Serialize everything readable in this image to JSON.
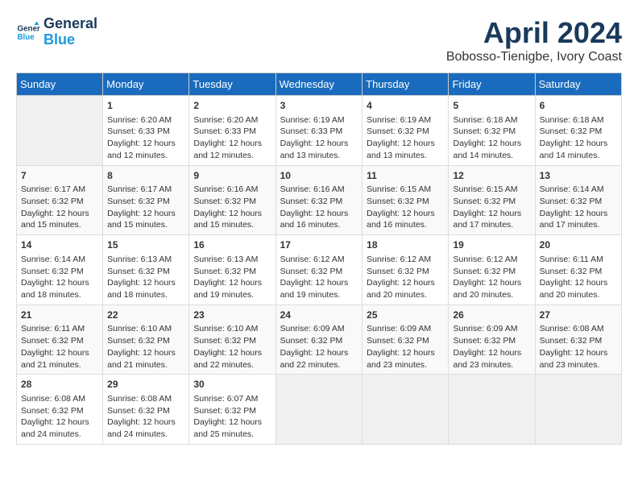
{
  "header": {
    "logo_line1": "General",
    "logo_line2": "Blue",
    "month": "April 2024",
    "location": "Bobosso-Tienigbe, Ivory Coast"
  },
  "days_of_week": [
    "Sunday",
    "Monday",
    "Tuesday",
    "Wednesday",
    "Thursday",
    "Friday",
    "Saturday"
  ],
  "weeks": [
    [
      {
        "num": "",
        "info": ""
      },
      {
        "num": "1",
        "info": "Sunrise: 6:20 AM\nSunset: 6:33 PM\nDaylight: 12 hours\nand 12 minutes."
      },
      {
        "num": "2",
        "info": "Sunrise: 6:20 AM\nSunset: 6:33 PM\nDaylight: 12 hours\nand 12 minutes."
      },
      {
        "num": "3",
        "info": "Sunrise: 6:19 AM\nSunset: 6:33 PM\nDaylight: 12 hours\nand 13 minutes."
      },
      {
        "num": "4",
        "info": "Sunrise: 6:19 AM\nSunset: 6:32 PM\nDaylight: 12 hours\nand 13 minutes."
      },
      {
        "num": "5",
        "info": "Sunrise: 6:18 AM\nSunset: 6:32 PM\nDaylight: 12 hours\nand 14 minutes."
      },
      {
        "num": "6",
        "info": "Sunrise: 6:18 AM\nSunset: 6:32 PM\nDaylight: 12 hours\nand 14 minutes."
      }
    ],
    [
      {
        "num": "7",
        "info": "Sunrise: 6:17 AM\nSunset: 6:32 PM\nDaylight: 12 hours\nand 15 minutes."
      },
      {
        "num": "8",
        "info": "Sunrise: 6:17 AM\nSunset: 6:32 PM\nDaylight: 12 hours\nand 15 minutes."
      },
      {
        "num": "9",
        "info": "Sunrise: 6:16 AM\nSunset: 6:32 PM\nDaylight: 12 hours\nand 15 minutes."
      },
      {
        "num": "10",
        "info": "Sunrise: 6:16 AM\nSunset: 6:32 PM\nDaylight: 12 hours\nand 16 minutes."
      },
      {
        "num": "11",
        "info": "Sunrise: 6:15 AM\nSunset: 6:32 PM\nDaylight: 12 hours\nand 16 minutes."
      },
      {
        "num": "12",
        "info": "Sunrise: 6:15 AM\nSunset: 6:32 PM\nDaylight: 12 hours\nand 17 minutes."
      },
      {
        "num": "13",
        "info": "Sunrise: 6:14 AM\nSunset: 6:32 PM\nDaylight: 12 hours\nand 17 minutes."
      }
    ],
    [
      {
        "num": "14",
        "info": "Sunrise: 6:14 AM\nSunset: 6:32 PM\nDaylight: 12 hours\nand 18 minutes."
      },
      {
        "num": "15",
        "info": "Sunrise: 6:13 AM\nSunset: 6:32 PM\nDaylight: 12 hours\nand 18 minutes."
      },
      {
        "num": "16",
        "info": "Sunrise: 6:13 AM\nSunset: 6:32 PM\nDaylight: 12 hours\nand 19 minutes."
      },
      {
        "num": "17",
        "info": "Sunrise: 6:12 AM\nSunset: 6:32 PM\nDaylight: 12 hours\nand 19 minutes."
      },
      {
        "num": "18",
        "info": "Sunrise: 6:12 AM\nSunset: 6:32 PM\nDaylight: 12 hours\nand 20 minutes."
      },
      {
        "num": "19",
        "info": "Sunrise: 6:12 AM\nSunset: 6:32 PM\nDaylight: 12 hours\nand 20 minutes."
      },
      {
        "num": "20",
        "info": "Sunrise: 6:11 AM\nSunset: 6:32 PM\nDaylight: 12 hours\nand 20 minutes."
      }
    ],
    [
      {
        "num": "21",
        "info": "Sunrise: 6:11 AM\nSunset: 6:32 PM\nDaylight: 12 hours\nand 21 minutes."
      },
      {
        "num": "22",
        "info": "Sunrise: 6:10 AM\nSunset: 6:32 PM\nDaylight: 12 hours\nand 21 minutes."
      },
      {
        "num": "23",
        "info": "Sunrise: 6:10 AM\nSunset: 6:32 PM\nDaylight: 12 hours\nand 22 minutes."
      },
      {
        "num": "24",
        "info": "Sunrise: 6:09 AM\nSunset: 6:32 PM\nDaylight: 12 hours\nand 22 minutes."
      },
      {
        "num": "25",
        "info": "Sunrise: 6:09 AM\nSunset: 6:32 PM\nDaylight: 12 hours\nand 23 minutes."
      },
      {
        "num": "26",
        "info": "Sunrise: 6:09 AM\nSunset: 6:32 PM\nDaylight: 12 hours\nand 23 minutes."
      },
      {
        "num": "27",
        "info": "Sunrise: 6:08 AM\nSunset: 6:32 PM\nDaylight: 12 hours\nand 23 minutes."
      }
    ],
    [
      {
        "num": "28",
        "info": "Sunrise: 6:08 AM\nSunset: 6:32 PM\nDaylight: 12 hours\nand 24 minutes."
      },
      {
        "num": "29",
        "info": "Sunrise: 6:08 AM\nSunset: 6:32 PM\nDaylight: 12 hours\nand 24 minutes."
      },
      {
        "num": "30",
        "info": "Sunrise: 6:07 AM\nSunset: 6:32 PM\nDaylight: 12 hours\nand 25 minutes."
      },
      {
        "num": "",
        "info": ""
      },
      {
        "num": "",
        "info": ""
      },
      {
        "num": "",
        "info": ""
      },
      {
        "num": "",
        "info": ""
      }
    ]
  ]
}
